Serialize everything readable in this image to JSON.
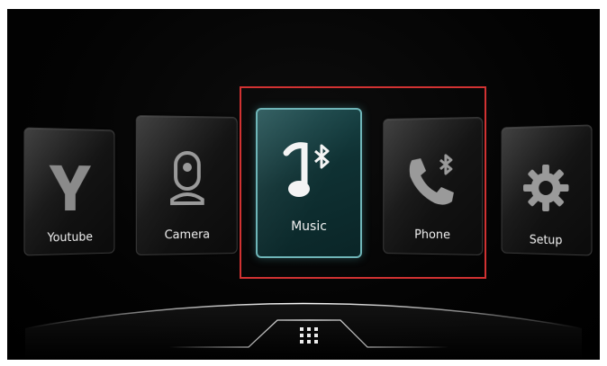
{
  "tiles": [
    {
      "key": "youtube",
      "label": "Youtube",
      "icon": "youtube-icon"
    },
    {
      "key": "camera",
      "label": "Camera",
      "icon": "camera-icon"
    },
    {
      "key": "music",
      "label": "Music",
      "icon": "bluetooth-music-icon",
      "selected": true
    },
    {
      "key": "phone",
      "label": "Phone",
      "icon": "bluetooth-phone-icon"
    },
    {
      "key": "setup",
      "label": "Setup",
      "icon": "gear-icon"
    }
  ],
  "dock": {
    "apps_icon": "app-grid-icon"
  },
  "colors": {
    "selection": "#d13232",
    "selected_tile": "#0f3133",
    "selected_border": "#6fb5b8",
    "tile_text": "#f2f2f2",
    "background": "#000000"
  }
}
